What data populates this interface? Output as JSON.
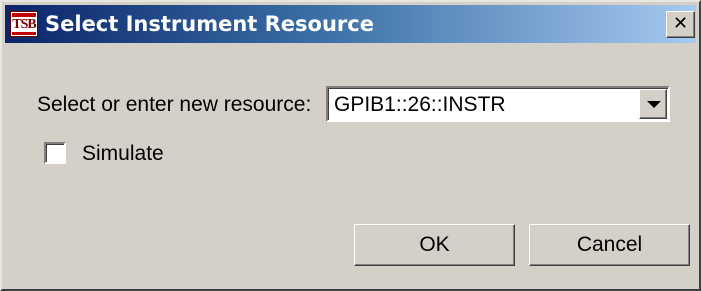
{
  "window": {
    "title": "Select Instrument Resource",
    "icon": "tsb-app-icon",
    "icon_text": "TSB",
    "close_glyph": "✕"
  },
  "form": {
    "resource_label": "Select or enter new resource:",
    "resource_value": "GPIB1::26::INSTR",
    "simulate_label": "Simulate",
    "simulate_checked": false
  },
  "buttons": {
    "ok_label": "OK",
    "cancel_label": "Cancel"
  },
  "colors": {
    "titlebar_start": "#0a246a",
    "titlebar_end": "#a6caf0",
    "dialog_face": "#d4d0c8"
  }
}
